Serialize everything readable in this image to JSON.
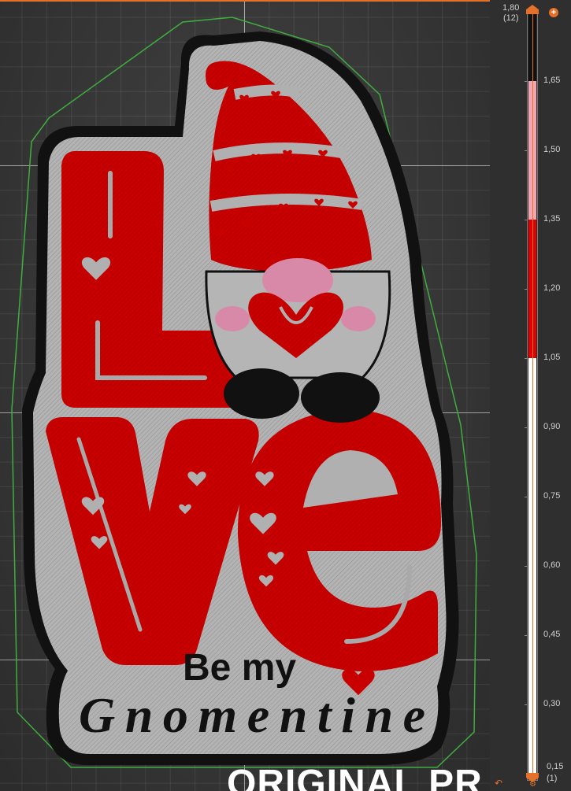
{
  "viewport": {
    "watermark_text": "ORIGINAL PR",
    "sticker_text": {
      "line1": "Be my",
      "line2": "Gnomentine"
    },
    "colors": {
      "red": "#c80000",
      "black": "#111111",
      "gray": "#a9a9a9",
      "pink": "#d889a8",
      "outline_green": "#3fae3f",
      "grid_line": "#bdbdbd"
    }
  },
  "layer_slider": {
    "top_value": "1,80",
    "top_layer": "(12)",
    "bottom_value": "0,15",
    "bottom_layer": "(1)",
    "ticks": [
      "1,65",
      "1,50",
      "1,35",
      "1,20",
      "1,05",
      "0,90",
      "0,75",
      "0,60",
      "0,45",
      "0,30"
    ],
    "segments": [
      {
        "from": "1,80",
        "to": "1,65",
        "color": "#111111"
      },
      {
        "from": "1,65",
        "to": "1,35",
        "color": "#f4a7b2"
      },
      {
        "from": "1,35",
        "to": "1,05",
        "color": "#e00000"
      },
      {
        "from": "1,05",
        "to": "0,15",
        "color": "#ffffff"
      }
    ],
    "accent_color": "#e4702a",
    "plus_icon": "plus-icon",
    "cog_icon": "cog-icon",
    "undo_icon": "undo-icon"
  }
}
